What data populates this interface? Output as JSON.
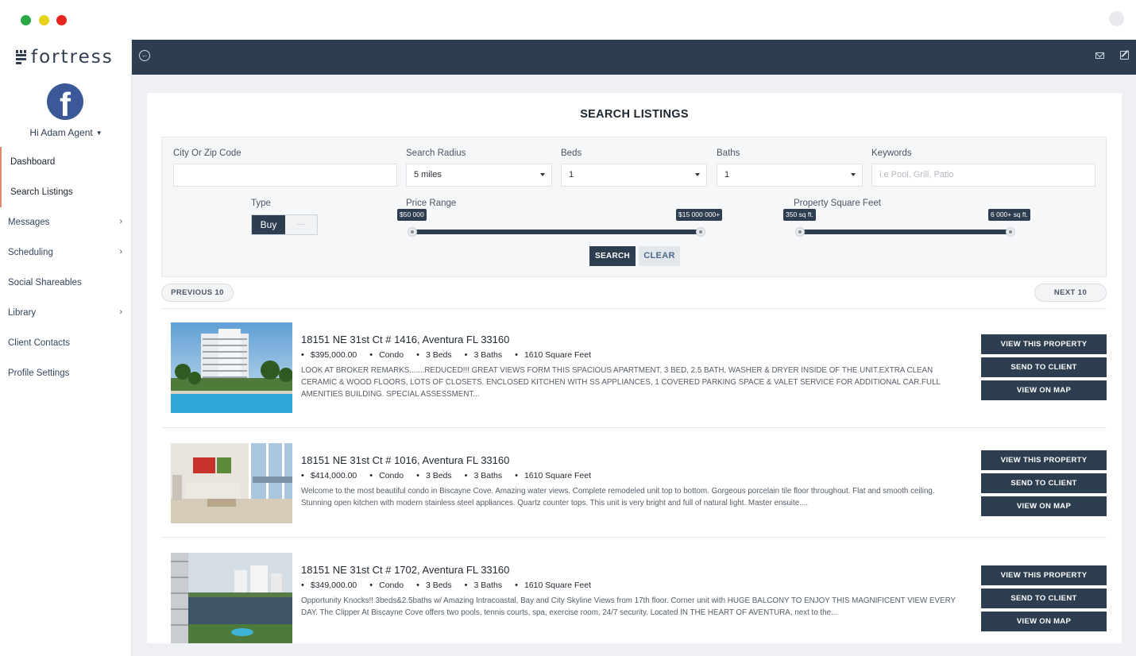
{
  "app": {
    "brand": "fortress"
  },
  "user": {
    "greeting": "Hi Adam Agent"
  },
  "sidebar": {
    "items": [
      {
        "label": "Dashboard",
        "active": true,
        "expandable": false
      },
      {
        "label": "Search Listings",
        "active": true,
        "expandable": false
      },
      {
        "label": "Messages",
        "active": false,
        "expandable": true
      },
      {
        "label": "Scheduling",
        "active": false,
        "expandable": true
      },
      {
        "label": "Social Shareables",
        "active": false,
        "expandable": false
      },
      {
        "label": "Library",
        "active": false,
        "expandable": true
      },
      {
        "label": "Client Contacts",
        "active": false,
        "expandable": false
      },
      {
        "label": "Profile Settings",
        "active": false,
        "expandable": false
      }
    ]
  },
  "search": {
    "title": "SEARCH LISTINGS",
    "city_label": "City Or Zip Code",
    "city_value": "",
    "radius_label": "Search Radius",
    "radius_value": "5 miles",
    "beds_label": "Beds",
    "beds_value": "1",
    "baths_label": "Baths",
    "baths_value": "1",
    "keywords_label": "Keywords",
    "keywords_placeholder": "i.e Pool, Grill, Patio",
    "type_label": "Type",
    "type_selected": "Buy",
    "type_other": "—",
    "price_label": "Price Range",
    "price_min": "$50 000",
    "price_max": "$15 000 000+",
    "sqft_label": "Property Square Feet",
    "sqft_min": "350 sq ft.",
    "sqft_max": "6 000+ sq ft.",
    "search_button": "SEARCH",
    "clear_button": "CLEAR"
  },
  "pagination": {
    "prev": "PREVIOUS 10",
    "next": "NEXT 10"
  },
  "listings": [
    {
      "address": "18151 NE 31st Ct # 1416, Aventura FL 33160",
      "price": "$395,000.00",
      "type": "Condo",
      "beds": "3 Beds",
      "baths": "3 Baths",
      "sqft": "1610 Square Feet",
      "description": "LOOK AT BROKER REMARKS.......REDUCED!!! GREAT VIEWS FORM THIS SPACIOUS APARTMENT, 3 BED, 2.5 BATH, WASHER & DRYER INSIDE OF THE UNIT.EXTRA CLEAN CERAMIC & WOOD FLOORS, LOTS OF CLOSETS. ENCLOSED KITCHEN WITH SS APPLIANCES, 1 COVERED PARKING SPACE & VALET SERVICE FOR ADDITIONAL CAR.FULL AMENITIES BUILDING. SPECIAL ASSESSMENT..."
    },
    {
      "address": "18151 NE 31st Ct # 1016, Aventura FL 33160",
      "price": "$414,000.00",
      "type": "Condo",
      "beds": "3 Beds",
      "baths": "3 Baths",
      "sqft": "1610 Square Feet",
      "description": "Welcome to the most beautiful condo in Biscayne Cove. Amazing water views. Complete remodeled unit top to bottom. Gorgeous porcelain tile floor throughout. Flat and smooth ceiling. Stunning open kitchen with modern stainless steel appliances. Quartz counter tops. This unit is very bright and full of natural light. Master ensuite...."
    },
    {
      "address": "18151 NE 31st Ct # 1702, Aventura FL 33160",
      "price": "$349,000.00",
      "type": "Condo",
      "beds": "3 Beds",
      "baths": "3 Baths",
      "sqft": "1610 Square Feet",
      "description": "Opportunity Knocks!! 3beds&2.5baths w/ Amazing Intracoastal, Bay and City Skyline Views from 17th floor. Corner unit with HUGE BALCONY TO ENJOY THIS MAGNIFICENT VIEW EVERY DAY. The Clipper At Biscayne Cove offers two pools, tennis courts, spa, exercise room, 24/7 security. Located IN THE HEART OF AVENTURA, next to the..."
    }
  ],
  "listing_actions": {
    "view": "VIEW THIS PROPERTY",
    "send": "SEND TO CLIENT",
    "map": "VIEW ON MAP"
  },
  "colors": {
    "navy": "#2d3e50",
    "accent": "#e08a67",
    "facebook": "#3b5998"
  }
}
